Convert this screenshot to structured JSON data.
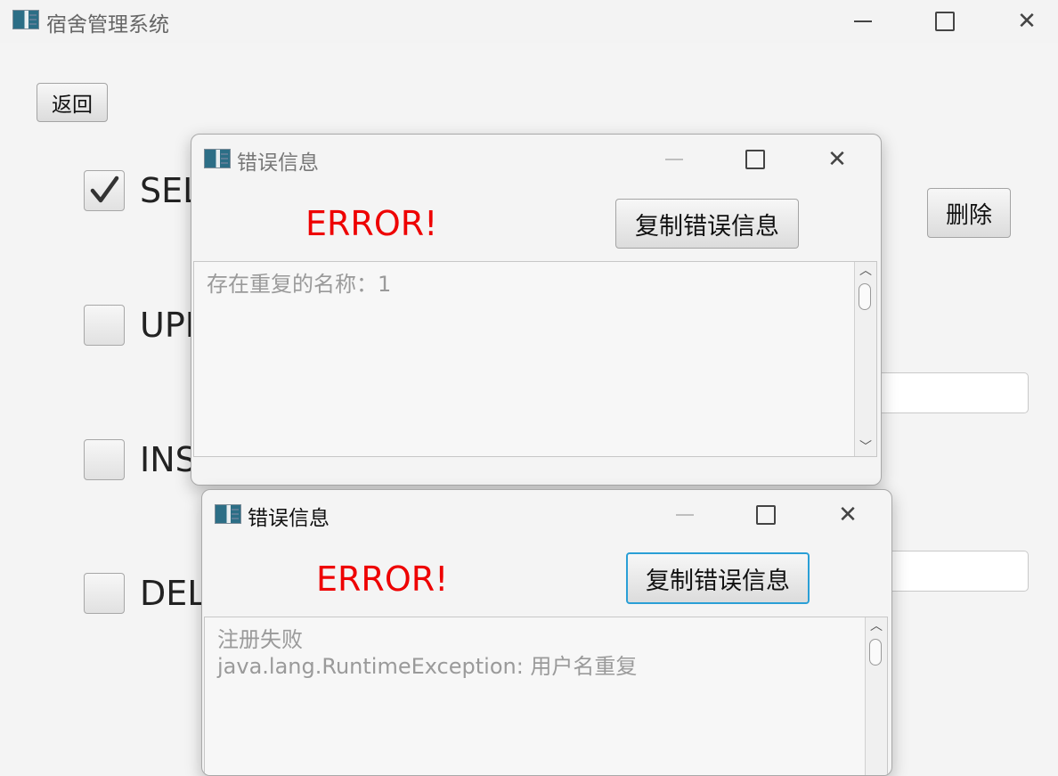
{
  "main_window": {
    "title": "宿舍管理系统",
    "back_button": "返回",
    "delete_button": "删除",
    "checkboxes": [
      {
        "label": "SEL",
        "checked": true
      },
      {
        "label": "UPD",
        "checked": false
      },
      {
        "label": "INS",
        "checked": false
      },
      {
        "label": "DELI",
        "checked": false
      }
    ]
  },
  "dialog1": {
    "title": "错误信息",
    "error_label": "ERROR!",
    "copy_button": "复制错误信息",
    "message": "存在重复的名称：1"
  },
  "dialog2": {
    "title": "错误信息",
    "error_label": "ERROR!",
    "copy_button": "复制错误信息",
    "message": "注册失败\njava.lang.RuntimeException: 用户名重复"
  },
  "colors": {
    "error_red": "#ee0000",
    "focus_blue": "#2a9fd6"
  }
}
